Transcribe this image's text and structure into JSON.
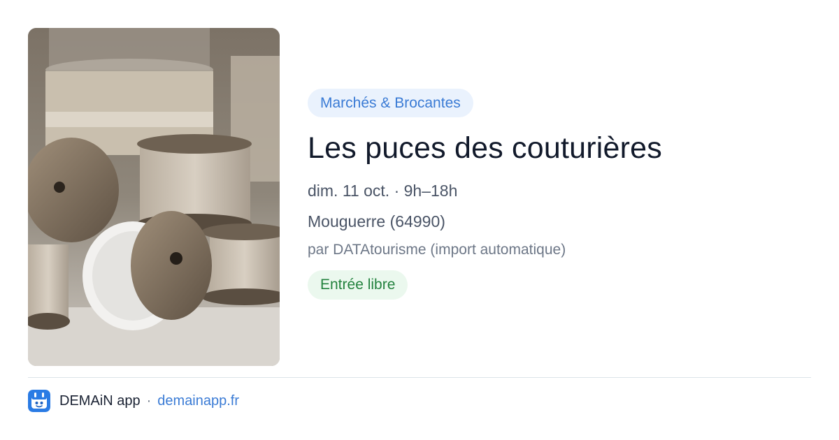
{
  "event": {
    "category": "Marchés & Brocantes",
    "title": "Les puces des couturières",
    "when": "dim. 11 oct. · 9h–18h",
    "where": "Mouguerre (64990)",
    "source": "par DATAtourisme (import automatique)",
    "price": "Entrée libre",
    "image_icon": "sewing-spools-photo"
  },
  "footer": {
    "app_name": "DEMAiN app",
    "separator": "·",
    "site": "demainapp.fr",
    "icon": "demain-app-icon"
  },
  "colors": {
    "accent": "#3a7bd5",
    "category_bg": "#eaf2fd",
    "price_text": "#23823e",
    "price_bg": "#ebf8ee",
    "divider": "#dbe3e8"
  }
}
